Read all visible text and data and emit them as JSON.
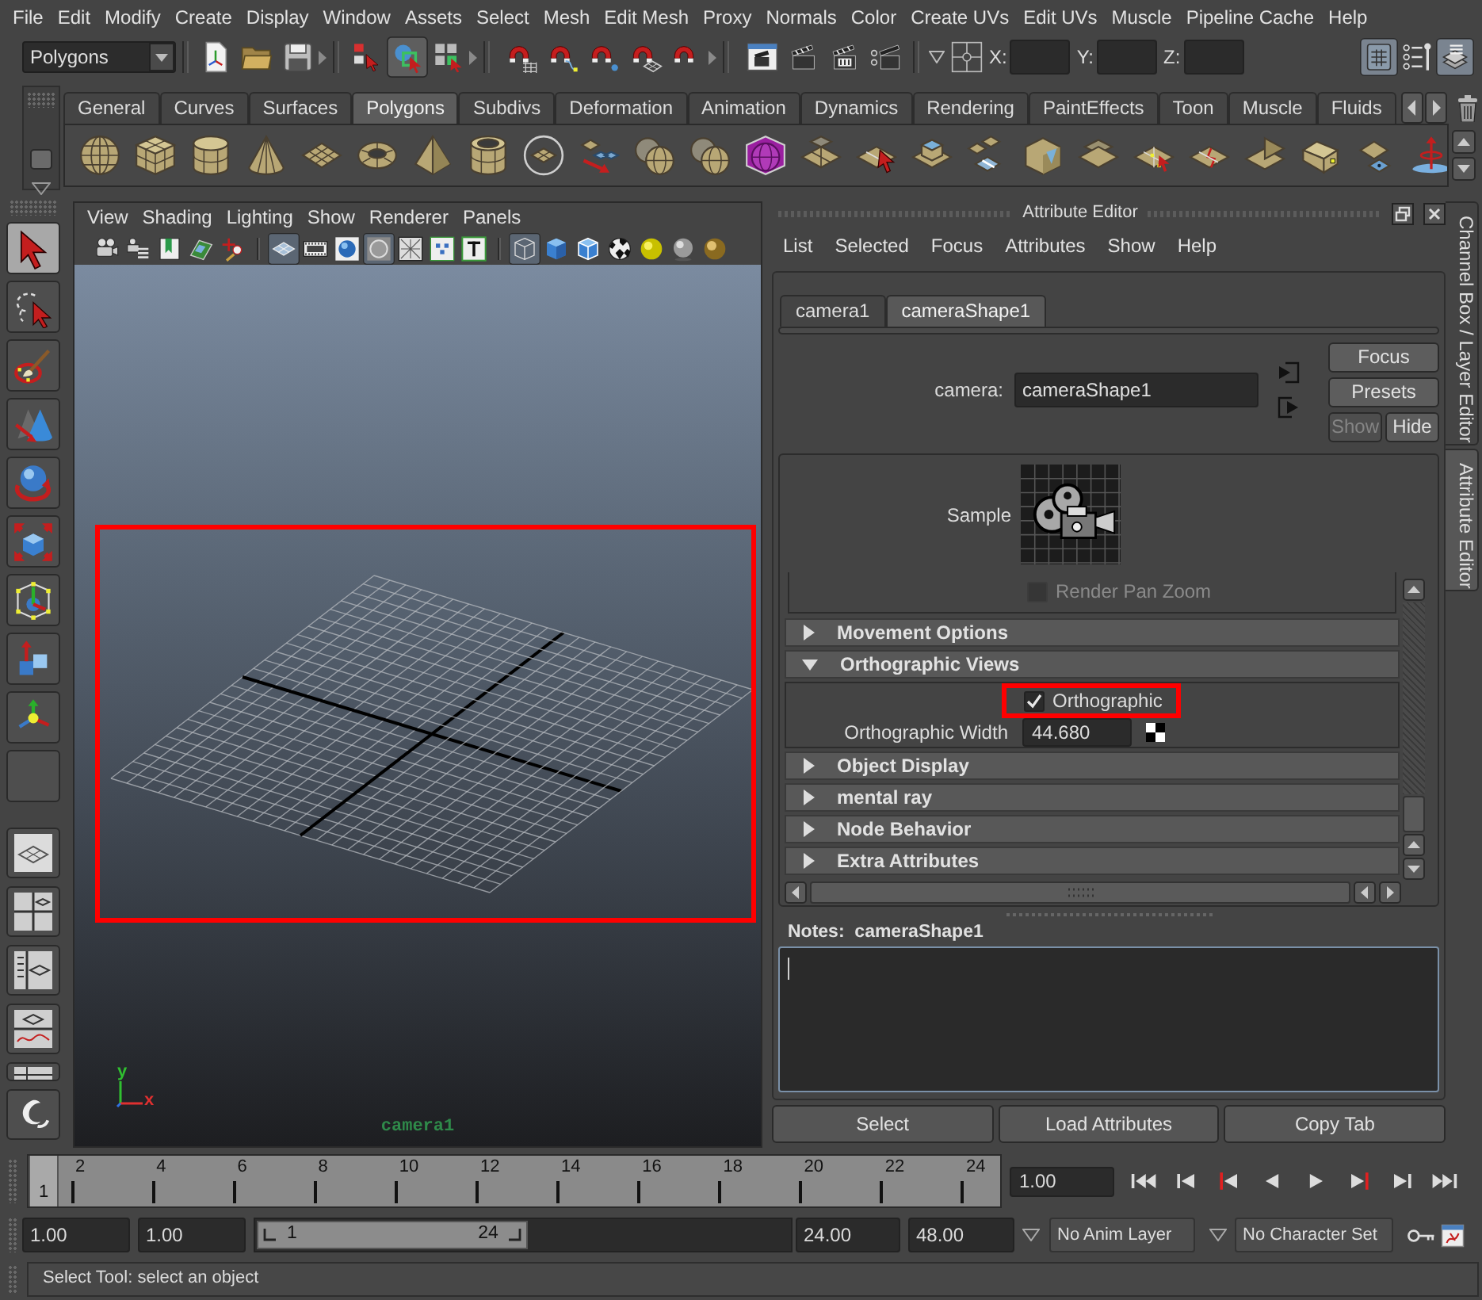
{
  "menu_bar": {
    "items": [
      "File",
      "Edit",
      "Modify",
      "Create",
      "Display",
      "Window",
      "Assets",
      "Select",
      "Mesh",
      "Edit Mesh",
      "Proxy",
      "Normals",
      "Color",
      "Create UVs",
      "Edit UVs",
      "Muscle",
      "Pipeline Cache",
      "Help"
    ]
  },
  "status_line": {
    "menu_set": "Polygons",
    "selection_modes": [
      {
        "selected": false
      },
      {
        "selected": true
      },
      {
        "selected": false
      }
    ],
    "coordinates": [
      {
        "label": "X:"
      },
      {
        "label": "Y:"
      },
      {
        "label": "Z:"
      }
    ],
    "panel_toggles": [
      {
        "on": true
      },
      {
        "on": false
      },
      {
        "on": true
      }
    ]
  },
  "shelf": {
    "tabs": [
      {
        "label": "General",
        "selected": false
      },
      {
        "label": "Curves",
        "selected": false
      },
      {
        "label": "Surfaces",
        "selected": false
      },
      {
        "label": "Polygons",
        "selected": true
      },
      {
        "label": "Subdivs",
        "selected": false
      },
      {
        "label": "Deformation",
        "selected": false
      },
      {
        "label": "Animation",
        "selected": false
      },
      {
        "label": "Dynamics",
        "selected": false
      },
      {
        "label": "Rendering",
        "selected": false
      },
      {
        "label": "PaintEffects",
        "selected": false
      },
      {
        "label": "Toon",
        "selected": false
      },
      {
        "label": "Muscle",
        "selected": false
      },
      {
        "label": "Fluids",
        "selected": false
      }
    ]
  },
  "toolbox": {
    "tools": [
      {
        "selected": true
      },
      {
        "selected": false
      },
      {
        "selected": false
      },
      {
        "selected": false
      },
      {
        "selected": false
      },
      {
        "selected": false
      },
      {
        "selected": false
      },
      {
        "selected": false
      },
      {
        "selected": false
      },
      {
        "selected": false
      }
    ]
  },
  "viewport": {
    "menu": [
      "View",
      "Shading",
      "Lighting",
      "Show",
      "Renderer",
      "Panels"
    ],
    "toggles": [
      {
        "on": false
      },
      {
        "on": false
      },
      {
        "on": false
      },
      {
        "on": false
      },
      {
        "on": false
      },
      {
        "on": true
      },
      {
        "on": false
      },
      {
        "on": false
      },
      {
        "on": true
      },
      {
        "on": false
      },
      {
        "on": false
      },
      {
        "on": false
      },
      {
        "on": true
      },
      {
        "on": false
      },
      {
        "on": false
      },
      {
        "on": false
      },
      {
        "on": false
      },
      {
        "on": false
      },
      {
        "on": false
      }
    ],
    "grid_highlighted": true,
    "axis_labels": [
      "y",
      "x"
    ],
    "camera_name": "camera1"
  },
  "attribute_editor": {
    "title": "Attribute Editor",
    "menu": [
      "List",
      "Selected",
      "Focus",
      "Attributes",
      "Show",
      "Help"
    ],
    "tabs": [
      {
        "label": "camera1",
        "selected": false
      },
      {
        "label": "cameraShape1",
        "selected": true
      }
    ],
    "node": {
      "label": "camera:",
      "value": "cameraShape1"
    },
    "buttons": [
      {
        "label": "Focus",
        "disabled": false
      },
      {
        "label": "Presets",
        "disabled": false
      },
      {
        "label": "Show",
        "disabled": true
      },
      {
        "label": "Hide",
        "disabled": false
      }
    ],
    "sample": {
      "label": "Sample"
    },
    "rows": [
      {
        "kind": "checkbox",
        "label": "Render Pan Zoom",
        "checked": false,
        "disabled": true
      },
      {
        "kind": "section",
        "label": "Movement Options",
        "expanded": false
      },
      {
        "kind": "section",
        "label": "Orthographic Views",
        "expanded": true,
        "attributes": [
          {
            "kind": "checkbox",
            "label": "Orthographic",
            "checked": true,
            "highlighted": true
          },
          {
            "kind": "number",
            "label": "Orthographic Width",
            "value": "44.680"
          }
        ]
      },
      {
        "kind": "section",
        "label": "Object Display",
        "expanded": false
      },
      {
        "kind": "section",
        "label": "mental ray",
        "expanded": false
      },
      {
        "kind": "section",
        "label": "Node Behavior",
        "expanded": false
      },
      {
        "kind": "section",
        "label": "Extra Attributes",
        "expanded": false
      }
    ],
    "notes": {
      "label": "Notes:  cameraShape1"
    },
    "actions": [
      "Select",
      "Load Attributes",
      "Copy Tab"
    ]
  },
  "side_tabs": [
    {
      "label": "Channel Box / Layer Editor",
      "selected": false
    },
    {
      "label": "Attribute Editor",
      "selected": true
    }
  ],
  "time_slider": {
    "frame_labels": [
      "2",
      "4",
      "6",
      "8",
      "10",
      "12",
      "14",
      "16",
      "18",
      "20",
      "22",
      "24"
    ],
    "current_frame": "1",
    "level": 0,
    "current_time": "1.00"
  },
  "range_slider": {
    "start_time": "1.00",
    "playback_start": "1.00",
    "range_start": "1",
    "range_end": "24",
    "level": 0.51,
    "playback_end": "24.00",
    "end_time": "48.00",
    "anim_layer": "No Anim Layer",
    "character_set": "No Character Set"
  },
  "help_line": {
    "text": "Select Tool: select an object"
  }
}
